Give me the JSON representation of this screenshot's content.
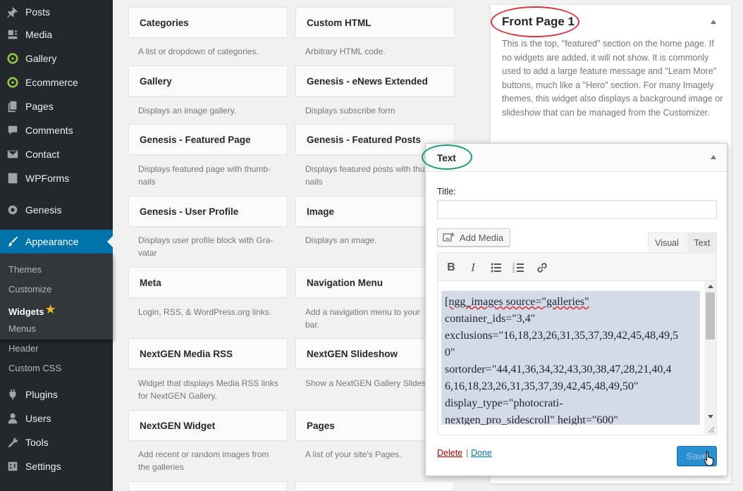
{
  "sidebar": {
    "items": [
      {
        "label": "Posts",
        "icon": "pin-icon"
      },
      {
        "label": "Media",
        "icon": "media-icon"
      },
      {
        "label": "Gallery",
        "icon": "nextgen-icon"
      },
      {
        "label": "Ecommerce",
        "icon": "nextgen-icon"
      },
      {
        "label": "Pages",
        "icon": "pages-icon"
      },
      {
        "label": "Comments",
        "icon": "comment-icon"
      },
      {
        "label": "Contact",
        "icon": "envelope-icon"
      },
      {
        "label": "WPForms",
        "icon": "forms-icon"
      },
      {
        "label": "Genesis",
        "icon": "genesis-icon"
      },
      {
        "label": "Appearance",
        "icon": "paintbrush-icon"
      }
    ],
    "appearance_submenu": [
      "Themes",
      "Customize",
      "Widgets",
      "Menus"
    ],
    "below_submenu": [
      "Header",
      "Custom CSS"
    ],
    "lower_items": [
      {
        "label": "Plugins",
        "icon": "plugin-icon"
      },
      {
        "label": "Users",
        "icon": "users-icon"
      },
      {
        "label": "Tools",
        "icon": "wrench-icon"
      },
      {
        "label": "Settings",
        "icon": "settings-icon"
      }
    ]
  },
  "widgets": {
    "left": [
      {
        "title": "Categories",
        "desc": "A list or dropdown of categories."
      },
      {
        "title": "Gallery",
        "desc": "Displays an image gallery."
      },
      {
        "title": "Genesis - Featured Page",
        "desc": "Displays featured page with thumb-\nnails"
      },
      {
        "title": "Genesis - User Profile",
        "desc": "Displays user profile block with Gra-\nvatar"
      },
      {
        "title": "Meta",
        "desc": "Login, RSS, & WordPress.org links."
      },
      {
        "title": "NextGEN Media RSS",
        "desc": "Widget that displays Media RSS links\nfor NextGEN Gallery."
      },
      {
        "title": "NextGEN Widget",
        "desc": "Add recent or random images from\nthe galleries"
      }
    ],
    "right": [
      {
        "title": "Custom HTML",
        "desc": "Arbitrary HTML code."
      },
      {
        "title": "Genesis - eNews Extended",
        "desc": "Displays subscribe form"
      },
      {
        "title": "Genesis - Featured Posts",
        "desc": "Displays featured posts with thu\nnails"
      },
      {
        "title": "Image",
        "desc": "Displays an image."
      },
      {
        "title": "Navigation Menu",
        "desc": "Add a navigation menu to your\nbar."
      },
      {
        "title": "NextGEN Slideshow",
        "desc": "Show a NextGEN Gallery Slidesho"
      },
      {
        "title": "Pages",
        "desc": "A list of your site's Pages."
      }
    ]
  },
  "front_panel": {
    "title": "Front Page 1",
    "description": "This is the top, \"featured\" section on the home page. If no widgets are added, it will not show. It is commonly used to add a large feature message and \"Learn More\" buttons, much like a \"Hero\" section. For many Imagely themes, this widget also displays a background image or slideshow that can be managed from the Customizer."
  },
  "text_widget": {
    "header": "Text",
    "title_label": "Title:",
    "title_value": "",
    "add_media_label": "Add Media",
    "tab_visual": "Visual",
    "tab_text": "Text",
    "toolbar": [
      "bold-icon",
      "italic-icon",
      "bullet-list-icon",
      "numbered-list-icon",
      "link-icon"
    ],
    "content_lines": [
      "[ngg_images source=\"galleries\"",
      "container_ids=\"3,4\"",
      "exclusions=\"16,18,23,26,31,35,37,39,42,45,48,49,5",
      "0\"",
      "sortorder=\"44,41,36,34,32,43,30,38,47,28,21,40,4",
      "6,16,18,23,26,31,35,37,39,42,45,48,49,50\"",
      "display_type=\"photocrati-",
      "nextgen_pro_sidescroll\" height=\"600\""
    ],
    "delete_label": "Delete",
    "separator": "|",
    "done_label": "Done",
    "save_label": "Save"
  },
  "colors": {
    "sidebar_bg": "#23282d",
    "active_blue": "#0073aa",
    "front_oval": "#d9363e",
    "text_oval": "#1a9b7a",
    "star": "#f6b521"
  }
}
